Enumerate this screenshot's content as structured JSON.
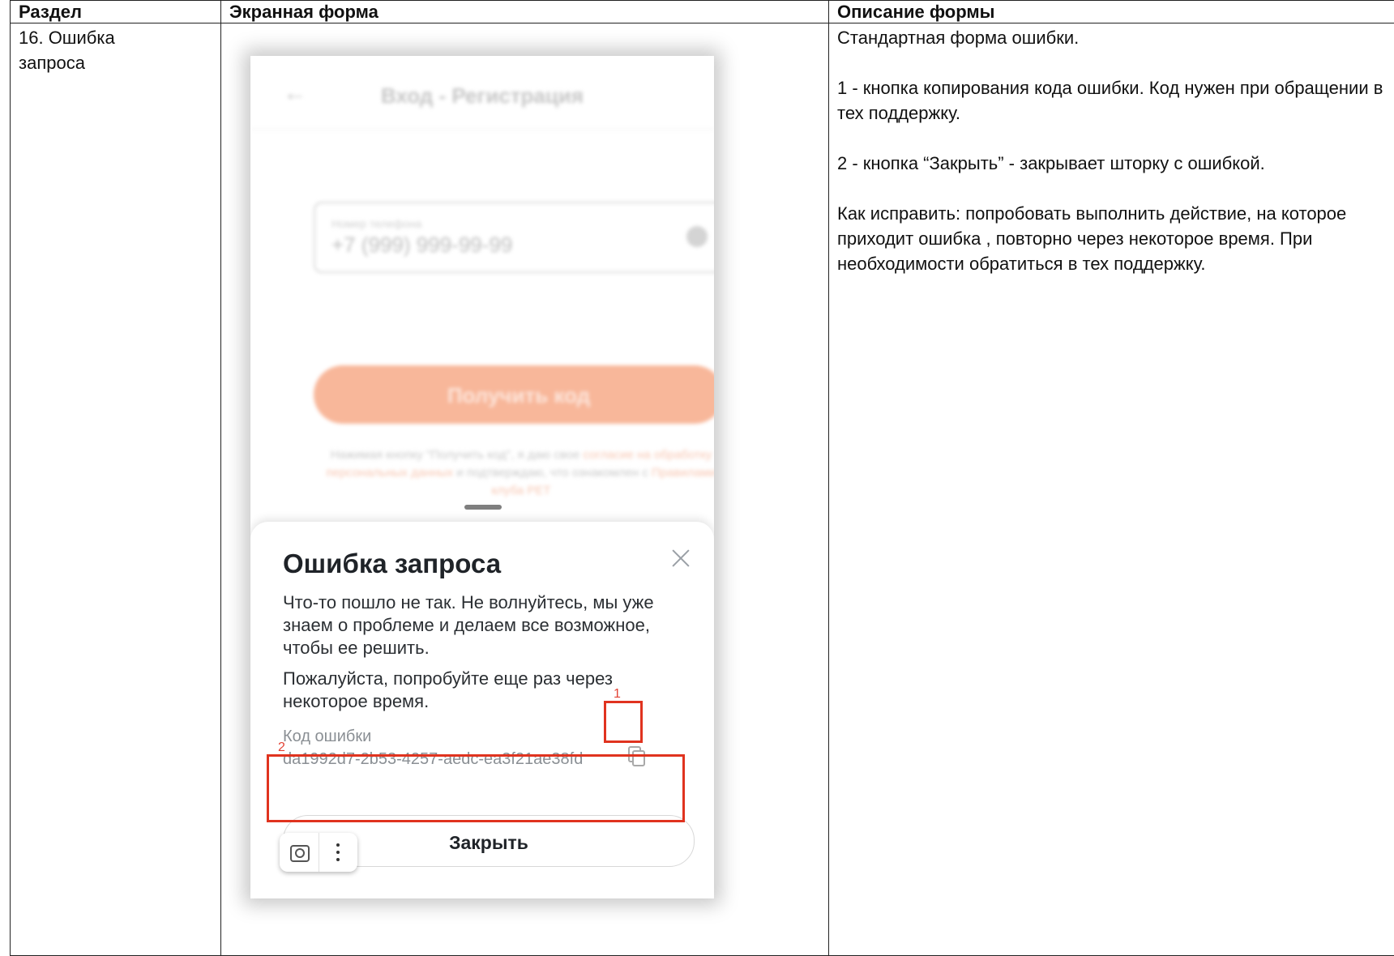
{
  "table": {
    "headers": [
      "Раздел",
      "Экранная форма",
      "Описание формы"
    ],
    "section": "16. Ошибка запроса",
    "description": [
      "Стандартная форма ошибки.",
      "1 - кнопка копирования кода ошибки. Код нужен при обращении в тех поддержку.",
      "2 - кнопка “Закрыть” - закрывает шторку с ошибкой.",
      "Как исправить: попробовать выполнить действие, на которое приходит ошибка , повторно через некоторое время. При необходимости обратиться в тех поддержку."
    ]
  },
  "screen": {
    "background": {
      "back_icon": "←",
      "title": "Вход - Регистрация",
      "phone_label": "Номер телефона",
      "phone_value": "+7 (999) 999-99-99",
      "get_code_button": "Получить код",
      "terms_text": "Нажимая кнопку \"Получить код\", я даю свое",
      "terms_link1": "согласие на обработку персональных данных",
      "terms_text2": "и подтверждаю, что ознакомлен с",
      "terms_link2": "Правилами клуба PET"
    },
    "sheet": {
      "title": "Ошибка запроса",
      "message1": "Что-то пошло не так. Не волнуйтесь, мы уже знаем о проблеме и делаем все возможное, чтобы ее решить.",
      "message2": "Пожалуйста, попробуйте еще раз через некоторое время.",
      "code_label": "Код ошибки",
      "code_value": "da1992d7-2b53-4257-aedc-ea3f21ae38fd",
      "close_button": "Закрыть"
    },
    "annotations": [
      "1",
      "2"
    ],
    "colors": {
      "annotation": "#e0331f",
      "accent_button": "#f8b79a"
    },
    "icons": [
      "back-arrow-icon",
      "clear-icon",
      "close-icon",
      "copy-icon",
      "camera-icon",
      "more-vertical-icon"
    ]
  }
}
